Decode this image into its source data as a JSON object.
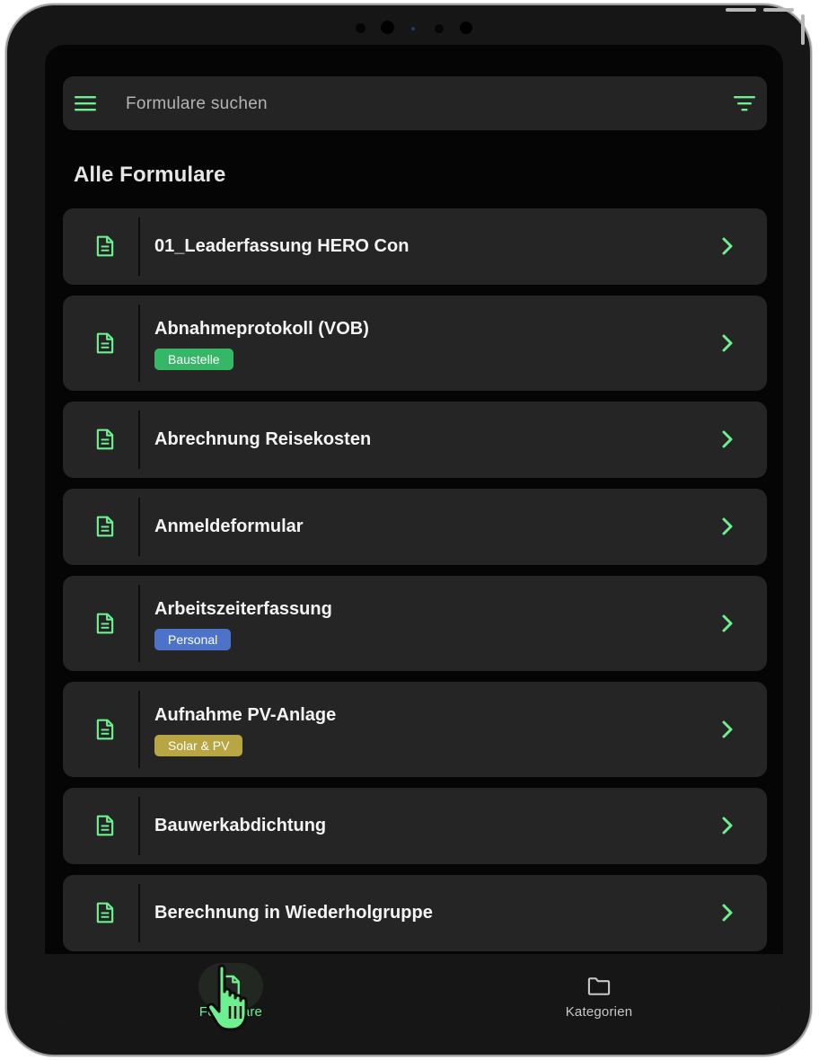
{
  "search": {
    "placeholder": "Formulare suchen"
  },
  "section": {
    "title": "Alle Formulare"
  },
  "forms": [
    {
      "title": "01_Leaderfassung HERO Con",
      "tag": ""
    },
    {
      "title": "Abnahmeprotokoll (VOB)",
      "tag": "Baustelle",
      "tag_color": "#35b767"
    },
    {
      "title": "Abrechnung Reisekosten",
      "tag": ""
    },
    {
      "title": "Anmeldeformular",
      "tag": ""
    },
    {
      "title": "Arbeitszeiterfassung",
      "tag": "Personal",
      "tag_color": "#4d72c9"
    },
    {
      "title": "Aufnahme PV-Anlage",
      "tag": "Solar & PV",
      "tag_color": "#b8a544"
    },
    {
      "title": "Bauwerkabdichtung",
      "tag": ""
    },
    {
      "title": "Berechnung in Wiederholgruppe",
      "tag": ""
    }
  ],
  "bottom_nav": {
    "formulare": {
      "label": "Formulare",
      "icon": "document-icon",
      "active": true
    },
    "kategorien": {
      "label": "Kategorien",
      "icon": "folder-icon",
      "active": false
    }
  },
  "colors": {
    "accent": "#6df08f",
    "card_bg": "#252525",
    "screen_bg": "#050505",
    "text": "#f4f4f4",
    "muted": "#bdbdbd"
  }
}
